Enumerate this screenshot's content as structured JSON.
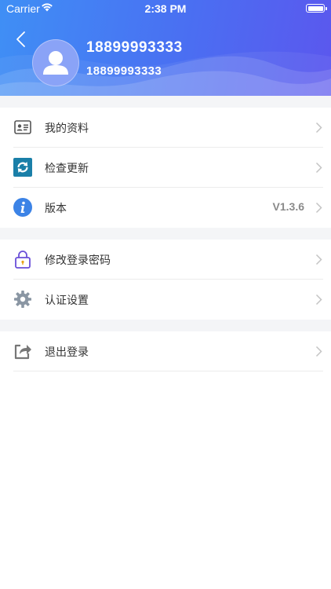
{
  "status_bar": {
    "carrier": "Carrier",
    "time": "2:38 PM"
  },
  "profile": {
    "name": "18899993333",
    "phone": "18899993333"
  },
  "menu_groups": [
    {
      "items": [
        {
          "label": "我的资料",
          "value": "",
          "icon": "id-card-icon"
        },
        {
          "label": "检查更新",
          "value": "",
          "icon": "refresh-icon"
        },
        {
          "label": "版本",
          "value": "V1.3.6",
          "icon": "info-icon"
        }
      ]
    },
    {
      "items": [
        {
          "label": "修改登录密码",
          "value": "",
          "icon": "lock-icon"
        },
        {
          "label": "认证设置",
          "value": "",
          "icon": "gear-icon"
        }
      ]
    },
    {
      "items": [
        {
          "label": "退出登录",
          "value": "",
          "icon": "share-exit-icon"
        }
      ]
    }
  ],
  "colors": {
    "header_start": "#3f8ff5",
    "header_end": "#5b57ee",
    "separator": "#f4f5f7"
  }
}
